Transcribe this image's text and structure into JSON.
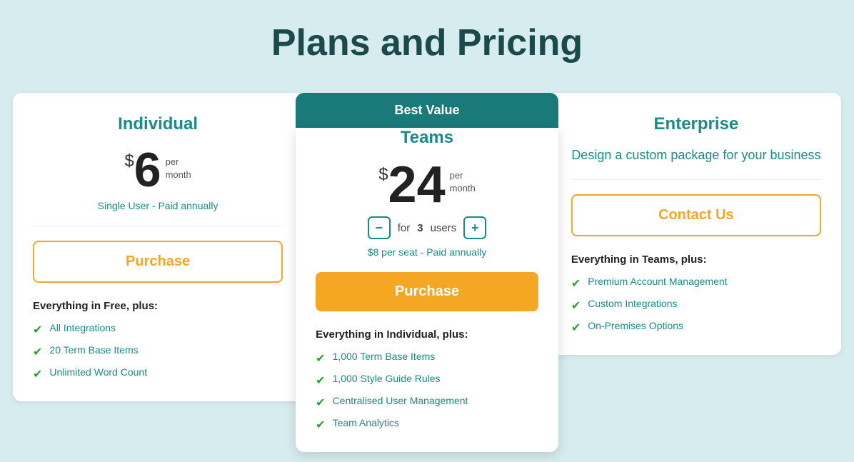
{
  "page": {
    "title": "Plans and Pricing",
    "background": "#d6ecee"
  },
  "plans": {
    "individual": {
      "name": "Individual",
      "price_dollar": "$",
      "price_amount": "6",
      "price_per": "per",
      "price_period": "month",
      "price_note": "Single User - Paid annually",
      "button_label": "Purchase",
      "features_heading": "Everything in Free, plus:",
      "features": [
        "All Integrations",
        "20 Term Base Items",
        "Unlimited Word Count"
      ]
    },
    "teams": {
      "badge": "Best Value",
      "name": "Teams",
      "price_dollar": "$",
      "price_amount": "24",
      "price_per": "per",
      "price_period": "month",
      "for_label": "for",
      "user_count": "3",
      "users_label": "users",
      "price_note": "$8 per seat - Paid annually",
      "button_label": "Purchase",
      "features_heading": "Everything in Individual, plus:",
      "features": [
        "1,000 Term Base Items",
        "1,000 Style Guide Rules",
        "Centralised User Management",
        "Team Analytics"
      ]
    },
    "enterprise": {
      "name": "Enterprise",
      "description": "Design a custom package for your business",
      "button_label": "Contact Us",
      "features_heading": "Everything in Teams, plus:",
      "features": [
        "Premium Account Management",
        "Custom Integrations",
        "On-Premises Options"
      ]
    }
  },
  "icons": {
    "check": "✔",
    "minus": "−",
    "plus": "+"
  }
}
